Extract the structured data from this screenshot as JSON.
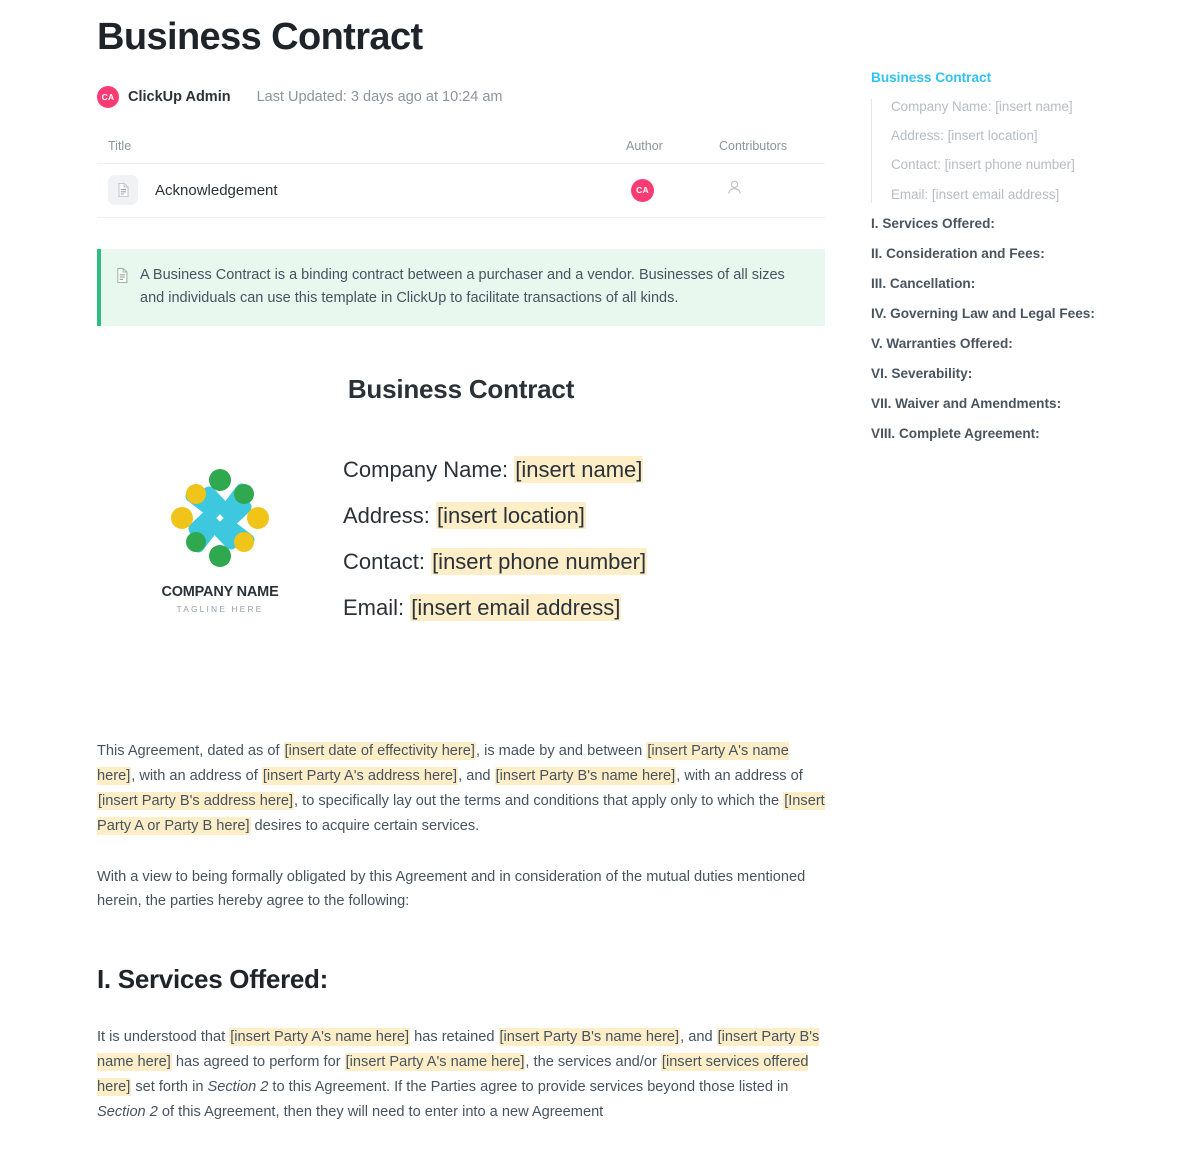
{
  "document": {
    "title": "Business Contract",
    "author": "ClickUp Admin",
    "author_initials": "CA",
    "last_updated": "Last Updated: 3 days ago at 10:24 am"
  },
  "table": {
    "headers": {
      "title": "Title",
      "author": "Author",
      "contributors": "Contributors"
    },
    "rows": [
      {
        "title": "Acknowledgement",
        "author_initials": "CA"
      }
    ]
  },
  "callout": {
    "text": "A Business Contract is a binding contract between a purchaser and a vendor. Businesses of all sizes and individuals can use this template in ClickUp to facilitate transactions of all kinds."
  },
  "content": {
    "center_heading": "Business Contract",
    "logo": {
      "name": "COMPANY NAME",
      "tagline": "TAGLINE HERE"
    },
    "fields": [
      {
        "label": "Company Name:",
        "value": "[insert name]"
      },
      {
        "label": "Address:",
        "value": "[insert location]"
      },
      {
        "label": "Contact:",
        "value": "[insert phone number]"
      },
      {
        "label": "Email:",
        "value": "[insert email address]"
      }
    ],
    "paragraph_1": {
      "t1": "This Agreement, dated as of ",
      "h1": "[insert date of effectivity here]",
      "t2": ", is made by and between ",
      "h2": "[insert Party A's name here]",
      "t3": ", with an address of ",
      "h3": "[insert Party A's address here]",
      "t4": ", and ",
      "h4": "[insert Party B's name here]",
      "t5": ", with an address of ",
      "h5": "[insert Party B's address here]",
      "t6": ", to specifically lay out the terms and conditions that apply only to which the ",
      "h6": "[Insert Party A or Party B here]",
      "t7": " desires to acquire certain services."
    },
    "paragraph_2": "With a view to being formally obligated by this Agreement and in consideration of the mutual duties mentioned herein, the parties hereby agree to the following:",
    "section_heading": "I. Services Offered:",
    "paragraph_3": {
      "t1": "It is understood that ",
      "h1": "[insert Party A's name here]",
      "t2": " has retained ",
      "h2": "[insert Party B's name here]",
      "t3": ", and ",
      "h3": "[insert Party B's name here]",
      "t4": " has agreed to perform for ",
      "h4": "[insert Party A's name here]",
      "t5": ", the services and/or ",
      "h5": "[insert services offered here]",
      "t6": " set forth in ",
      "i1": "Section 2",
      "t7": " to this Agreement. If the Parties agree to provide services beyond those listed in ",
      "i2": "Section 2",
      "t8": " of this Agreement, then they will need to enter into a new Agreement"
    }
  },
  "toc": {
    "active": "Business Contract",
    "sub_items": [
      "Company Name: [insert name]",
      "Address: [insert location]",
      "Contact: [insert phone number]",
      "Email: [insert email address]"
    ],
    "items": [
      "I. Services Offered:",
      "II. Consideration and Fees:",
      "III. Cancellation:",
      "IV. Governing Law and Legal Fees:",
      "V. Warranties Offered:",
      "VI. Severability:",
      "VII. Waiver and Amendments:",
      "VIII. Complete Agreement:"
    ]
  },
  "colors": {
    "accent_blue": "#31c2f0",
    "avatar_pink": "#fb3c74",
    "callout_green": "#2fbd85",
    "highlight": "#fdeec8",
    "logo_cyan": "#3ec8e0",
    "logo_green": "#2fa84f",
    "logo_yellow": "#f0c419"
  }
}
